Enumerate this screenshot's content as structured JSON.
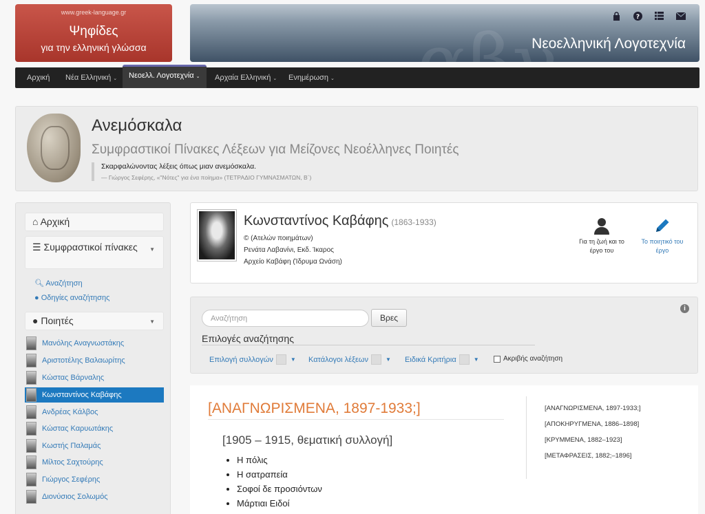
{
  "brand": {
    "url": "www.greek-language.gr",
    "title": "Ψηφίδες",
    "subtitle": "για την ελληνική γλώσσα"
  },
  "banner": {
    "title": "Νεοελληνική Λογοτεχνία",
    "watermark": "αβγ"
  },
  "nav": {
    "items": [
      {
        "label": "Αρχική"
      },
      {
        "label": "Νέα Ελληνική"
      },
      {
        "label": "Νεοελλ. Λογοτεχνία"
      },
      {
        "label": "Αρχαία Ελληνική"
      },
      {
        "label": "Ενημέρωση"
      }
    ]
  },
  "hero": {
    "title": "Ανεμόσκαλα",
    "subtitle": "Συμφραστικοί Πίνακες Λέξεων για Μείζονες Νεοέλληνες Ποιητές",
    "quote": "Σκαρφαλώνοντας λέξεις όπως μιαν ανεμόσκαλα.",
    "source": "— Γιώργος Σεφέρης, «\"Νότες\" για ένα ποίημα» (ΤΕΤΡΑΔΙΟ ΓΥΜΝΑΣΜΑΤΩΝ, Β΄)"
  },
  "sidebar": {
    "home": "Αρχική",
    "tables": "Συμφραστικοί πίνακες",
    "search_link": "Αναζήτηση",
    "help_link": "Οδηγίες αναζήτησης",
    "poets_label": "Ποιητές",
    "poets": [
      "Μανόλης Αναγνωστάκης",
      "Αριστοτέλης Βαλαωρίτης",
      "Κώστας Βάρναλης",
      "Κωνσταντίνος Καβάφης",
      "Ανδρέας Κάλβος",
      "Κώστας Καρυωτάκης",
      "Κωστής Παλαμάς",
      "Μίλτος Σαχτούρης",
      "Γιώργος Σεφέρης",
      "Διονύσιος Σολωμός"
    ],
    "selected": "Κωνσταντίνος Καβάφης"
  },
  "author": {
    "name": "Κωνσταντίνος Καβάφης",
    "years": "(1863-1933)",
    "line1": "© (Ατελών ποιημάτων)",
    "line2": "Ρενάτα Λαβανίνι, Εκδ. Ίκαρος",
    "line3": "Αρχείο Καβάφη (Ίδρυμα Ωνάση)",
    "life_label": "Για τη ζωή και το έργο του",
    "work_label": "Το ποιητικό του έργο"
  },
  "search": {
    "placeholder": "Αναζήτηση",
    "button": "Βρες",
    "options_title": "Επιλογές αναζήτησης",
    "dd1": "Επιλογή συλλογών",
    "dd2": "Κατάλογοι λέξεων",
    "dd3": "Ειδικά Κριτήρια",
    "exact": "Ακριβής αναζήτηση"
  },
  "content": {
    "section": "[ΑΝΑΓΝΩΡΙΣΜΕΝΑ, 1897-1933;]",
    "subsection": "[1905 – 1915, θεματική συλλογή]",
    "poems": [
      "Η πόλις",
      "Η σατραπεία",
      "Σοφοί δε προσιόντων",
      "Μάρτιαι Ειδοί"
    ],
    "toc": [
      "[ΑΝΑΓΝΩΡΙΣΜΕΝΑ, 1897-1933;]",
      "[ΑΠΟΚΗΡΥΓΜΕΝΑ, 1886–1898]",
      "[ΚΡΥΜΜΕΝΑ, 1882–1923]",
      "[ΜΕΤΑΦΡΑΣΕΙΣ, 1882;–1896]"
    ]
  },
  "colors": {
    "brand": "#b8443a",
    "link": "#337ab7",
    "selected": "#1c79c0",
    "accent": "#e07b39"
  }
}
